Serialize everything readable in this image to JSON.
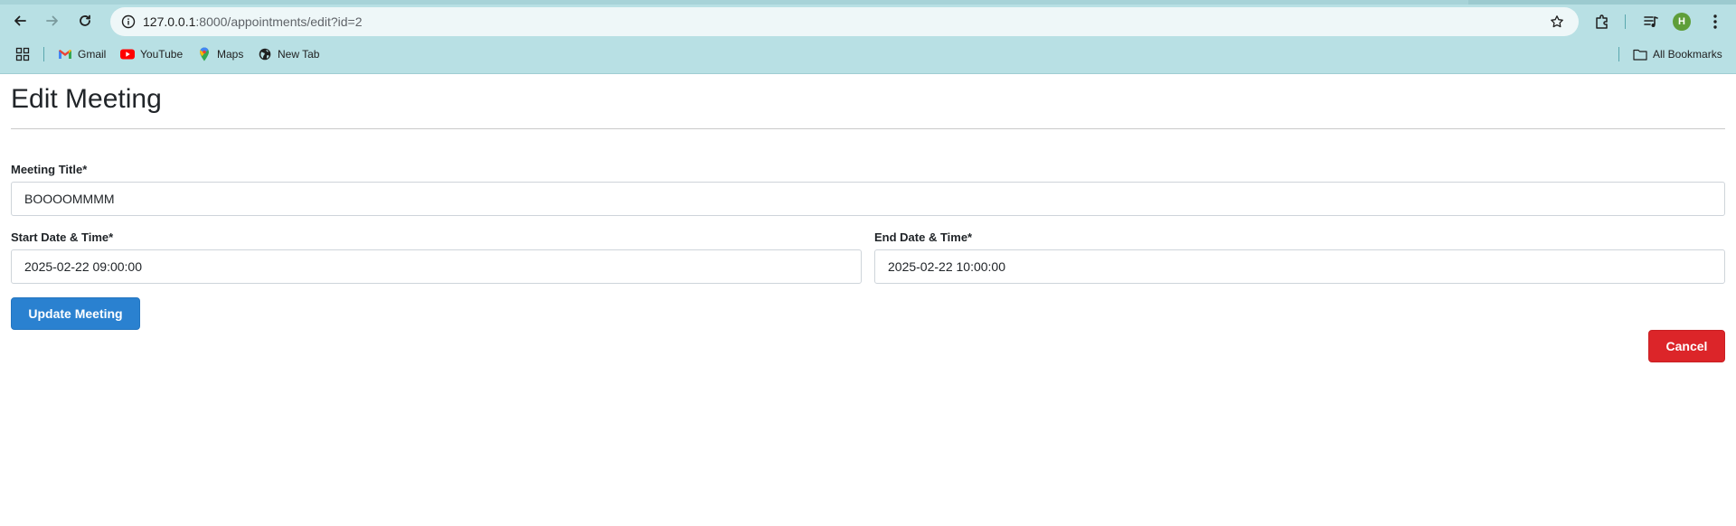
{
  "browser": {
    "url_host": "127.0.0.1",
    "url_path": ":8000/appointments/edit?id=2",
    "profile_initial": "H",
    "bookmarks": [
      {
        "label": "Gmail",
        "icon": "gmail-icon"
      },
      {
        "label": "YouTube",
        "icon": "youtube-icon"
      },
      {
        "label": "Maps",
        "icon": "maps-icon"
      },
      {
        "label": "New Tab",
        "icon": "globe-icon"
      }
    ],
    "all_bookmarks_label": "All Bookmarks",
    "chrome_color": "#b8e0e4"
  },
  "page": {
    "title": "Edit Meeting",
    "form": {
      "meeting_title_label": "Meeting Title*",
      "meeting_title_value": "BOOOOMMMM",
      "start_label": "Start Date & Time*",
      "start_value": "2025-02-22 09:00:00",
      "end_label": "End Date & Time*",
      "end_value": "2025-02-22 10:00:00"
    },
    "update_button": "Update Meeting",
    "cancel_button": "Cancel",
    "colors": {
      "primary": "#2a81d0",
      "danger": "#dc2529"
    }
  }
}
